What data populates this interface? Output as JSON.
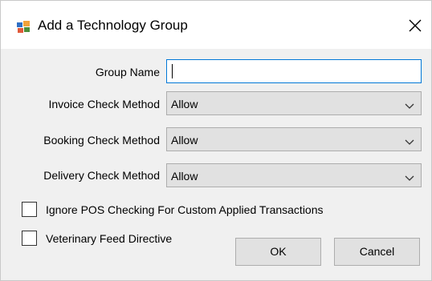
{
  "window": {
    "title": "Add a Technology Group",
    "icon": "app-window-icon",
    "close_icon": "close-icon"
  },
  "form": {
    "group_name": {
      "label": "Group Name",
      "value": ""
    },
    "invoice_check_method": {
      "label": "Invoice Check Method",
      "value": "Allow"
    },
    "booking_check_method": {
      "label": "Booking Check Method",
      "value": "Allow"
    },
    "delivery_check_method": {
      "label": "Delivery Check Method",
      "value": "Allow"
    }
  },
  "options": {
    "ignore_pos": {
      "label": "Ignore POS Checking For Custom Applied Transactions",
      "checked": false
    },
    "vfd": {
      "label": "Veterinary Feed Directive",
      "checked": false
    }
  },
  "buttons": {
    "ok": "OK",
    "cancel": "Cancel"
  },
  "colors": {
    "focus_border": "#0078d7",
    "dialog_bg": "#f0f0f0",
    "control_bg": "#e1e1e1"
  }
}
